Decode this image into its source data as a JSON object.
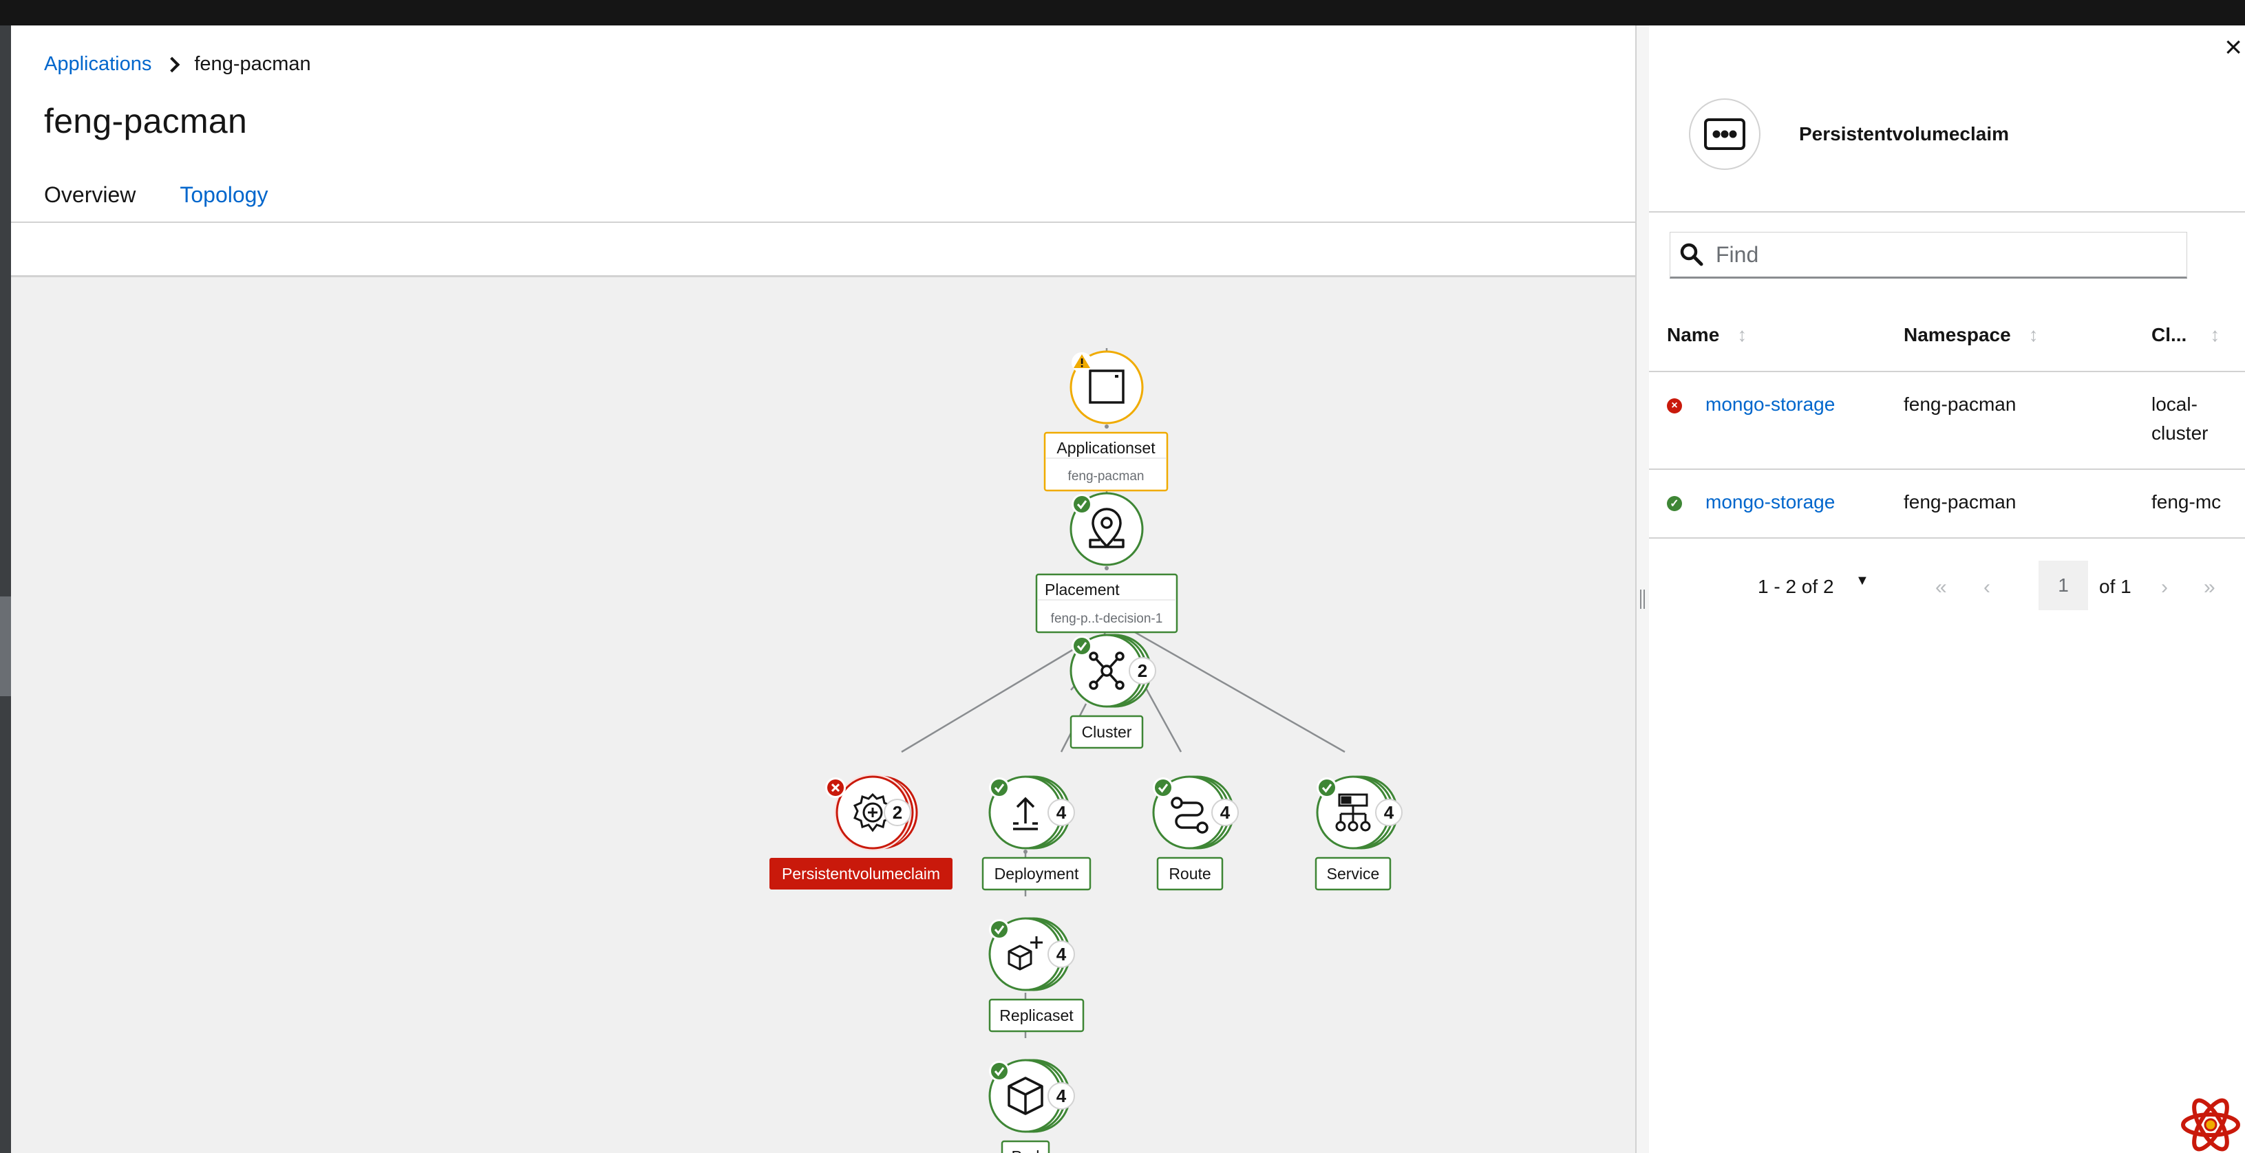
{
  "breadcrumb": {
    "root": "Applications",
    "current": "feng-pacman"
  },
  "page": {
    "title": "feng-pacman"
  },
  "tabs": [
    {
      "label": "Overview"
    },
    {
      "label": "Topology",
      "active": true
    }
  ],
  "topology": {
    "nodes": {
      "applicationset": {
        "label": "Applicationset",
        "sublabel": "feng-pacman",
        "status": "warning",
        "icon": "application-icon"
      },
      "placement": {
        "label": "Placement",
        "sublabel": "feng-p..t-decision-1",
        "status": "ok",
        "icon": "map-marker-icon"
      },
      "cluster": {
        "label": "Cluster",
        "count": "2",
        "status": "ok",
        "icon": "cluster-icon"
      },
      "pvc": {
        "label": "Persistentvolumeclaim",
        "count": "2",
        "status": "error",
        "icon": "pvc-icon"
      },
      "deployment": {
        "label": "Deployment",
        "count": "4",
        "status": "ok",
        "icon": "deployment-icon"
      },
      "route": {
        "label": "Route",
        "count": "4",
        "status": "ok",
        "icon": "route-icon"
      },
      "service": {
        "label": "Service",
        "count": "4",
        "status": "ok",
        "icon": "service-icon"
      },
      "replicaset": {
        "label": "Replicaset",
        "count": "4",
        "status": "ok",
        "icon": "replicaset-icon"
      },
      "pod": {
        "label": "Pod",
        "count": "4",
        "status": "ok",
        "icon": "pod-icon"
      }
    }
  },
  "panel": {
    "title": "Persistentvolumeclaim",
    "icon": "more-horizontal-icon",
    "search_placeholder": "Find",
    "columns": [
      {
        "label": "Name"
      },
      {
        "label": "Namespace"
      },
      {
        "label": "Cl..."
      }
    ],
    "rows": [
      {
        "status": "error",
        "name": "mongo-storage",
        "namespace": "feng-pacman",
        "cluster_line1": "local-",
        "cluster_line2": "cluster"
      },
      {
        "status": "ok",
        "name": "mongo-storage",
        "namespace": "feng-pacman",
        "cluster_line1": "feng-mc",
        "cluster_line2": ""
      }
    ],
    "pagination": {
      "range": "1 - 2 of 2",
      "page": "1",
      "of": "of 1"
    }
  },
  "colors": {
    "link": "#0066cc",
    "ok": "#3e8635",
    "error": "#c9190b",
    "warning": "#f0ab00"
  }
}
